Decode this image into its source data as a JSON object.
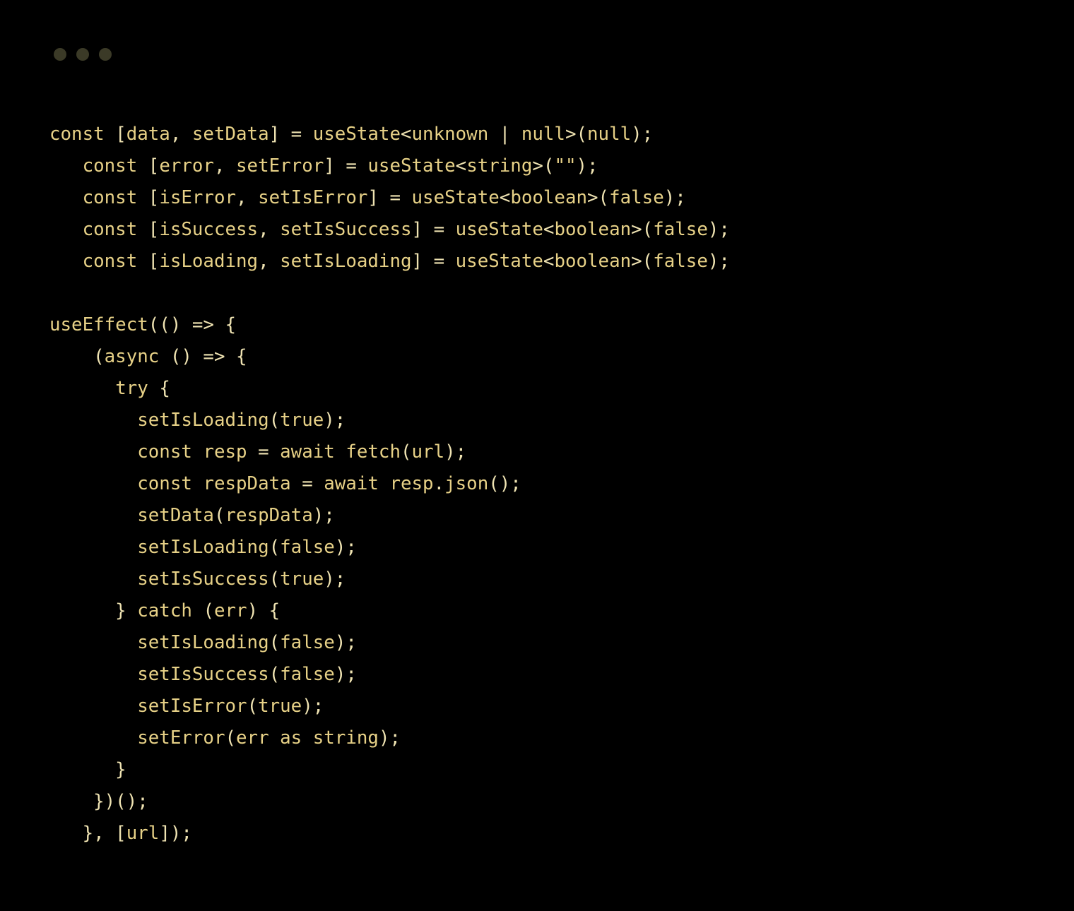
{
  "window": {
    "dots": [
      "close",
      "minimize",
      "zoom"
    ]
  },
  "code": {
    "language": "typescript",
    "tokens": [
      [
        {
          "t": "const ",
          "c": "kw"
        },
        {
          "t": "[",
          "c": "pn"
        },
        {
          "t": "data",
          "c": "id"
        },
        {
          "t": ", ",
          "c": "pn"
        },
        {
          "t": "setData",
          "c": "id"
        },
        {
          "t": "] = ",
          "c": "pn"
        },
        {
          "t": "useState",
          "c": "fn"
        },
        {
          "t": "<",
          "c": "pn"
        },
        {
          "t": "unknown",
          "c": "typ"
        },
        {
          "t": " | ",
          "c": "pn"
        },
        {
          "t": "null",
          "c": "lit"
        },
        {
          "t": ">(",
          "c": "pn"
        },
        {
          "t": "null",
          "c": "lit"
        },
        {
          "t": ");",
          "c": "pn"
        }
      ],
      [
        {
          "t": "   ",
          "c": "pn"
        },
        {
          "t": "const ",
          "c": "kw"
        },
        {
          "t": "[",
          "c": "pn"
        },
        {
          "t": "error",
          "c": "id"
        },
        {
          "t": ", ",
          "c": "pn"
        },
        {
          "t": "setError",
          "c": "id"
        },
        {
          "t": "] = ",
          "c": "pn"
        },
        {
          "t": "useState",
          "c": "fn"
        },
        {
          "t": "<",
          "c": "pn"
        },
        {
          "t": "string",
          "c": "typ"
        },
        {
          "t": ">(",
          "c": "pn"
        },
        {
          "t": "\"\"",
          "c": "str"
        },
        {
          "t": ");",
          "c": "pn"
        }
      ],
      [
        {
          "t": "   ",
          "c": "pn"
        },
        {
          "t": "const ",
          "c": "kw"
        },
        {
          "t": "[",
          "c": "pn"
        },
        {
          "t": "isError",
          "c": "id"
        },
        {
          "t": ", ",
          "c": "pn"
        },
        {
          "t": "setIsError",
          "c": "id"
        },
        {
          "t": "] = ",
          "c": "pn"
        },
        {
          "t": "useState",
          "c": "fn"
        },
        {
          "t": "<",
          "c": "pn"
        },
        {
          "t": "boolean",
          "c": "typ"
        },
        {
          "t": ">(",
          "c": "pn"
        },
        {
          "t": "false",
          "c": "lit"
        },
        {
          "t": ");",
          "c": "pn"
        }
      ],
      [
        {
          "t": "   ",
          "c": "pn"
        },
        {
          "t": "const ",
          "c": "kw"
        },
        {
          "t": "[",
          "c": "pn"
        },
        {
          "t": "isSuccess",
          "c": "id"
        },
        {
          "t": ", ",
          "c": "pn"
        },
        {
          "t": "setIsSuccess",
          "c": "id"
        },
        {
          "t": "] = ",
          "c": "pn"
        },
        {
          "t": "useState",
          "c": "fn"
        },
        {
          "t": "<",
          "c": "pn"
        },
        {
          "t": "boolean",
          "c": "typ"
        },
        {
          "t": ">(",
          "c": "pn"
        },
        {
          "t": "false",
          "c": "lit"
        },
        {
          "t": ");",
          "c": "pn"
        }
      ],
      [
        {
          "t": "   ",
          "c": "pn"
        },
        {
          "t": "const ",
          "c": "kw"
        },
        {
          "t": "[",
          "c": "pn"
        },
        {
          "t": "isLoading",
          "c": "id"
        },
        {
          "t": ", ",
          "c": "pn"
        },
        {
          "t": "setIsLoading",
          "c": "id"
        },
        {
          "t": "] = ",
          "c": "pn"
        },
        {
          "t": "useState",
          "c": "fn"
        },
        {
          "t": "<",
          "c": "pn"
        },
        {
          "t": "boolean",
          "c": "typ"
        },
        {
          "t": ">(",
          "c": "pn"
        },
        {
          "t": "false",
          "c": "lit"
        },
        {
          "t": ");",
          "c": "pn"
        }
      ],
      [],
      [
        {
          "t": "useEffect",
          "c": "fn"
        },
        {
          "t": "(() => {",
          "c": "pn"
        }
      ],
      [
        {
          "t": "    (",
          "c": "pn"
        },
        {
          "t": "async ",
          "c": "kw"
        },
        {
          "t": "() => {",
          "c": "pn"
        }
      ],
      [
        {
          "t": "      ",
          "c": "pn"
        },
        {
          "t": "try ",
          "c": "kw"
        },
        {
          "t": "{",
          "c": "pn"
        }
      ],
      [
        {
          "t": "        ",
          "c": "pn"
        },
        {
          "t": "setIsLoading",
          "c": "fn"
        },
        {
          "t": "(",
          "c": "pn"
        },
        {
          "t": "true",
          "c": "lit"
        },
        {
          "t": ");",
          "c": "pn"
        }
      ],
      [
        {
          "t": "        ",
          "c": "pn"
        },
        {
          "t": "const ",
          "c": "kw"
        },
        {
          "t": "resp",
          "c": "id"
        },
        {
          "t": " = ",
          "c": "pn"
        },
        {
          "t": "await ",
          "c": "kw"
        },
        {
          "t": "fetch",
          "c": "fn"
        },
        {
          "t": "(",
          "c": "pn"
        },
        {
          "t": "url",
          "c": "id"
        },
        {
          "t": ");",
          "c": "pn"
        }
      ],
      [
        {
          "t": "        ",
          "c": "pn"
        },
        {
          "t": "const ",
          "c": "kw"
        },
        {
          "t": "respData",
          "c": "id"
        },
        {
          "t": " = ",
          "c": "pn"
        },
        {
          "t": "await ",
          "c": "kw"
        },
        {
          "t": "resp",
          "c": "id"
        },
        {
          "t": ".",
          "c": "pn"
        },
        {
          "t": "json",
          "c": "fn"
        },
        {
          "t": "();",
          "c": "pn"
        }
      ],
      [
        {
          "t": "        ",
          "c": "pn"
        },
        {
          "t": "setData",
          "c": "fn"
        },
        {
          "t": "(",
          "c": "pn"
        },
        {
          "t": "respData",
          "c": "id"
        },
        {
          "t": ");",
          "c": "pn"
        }
      ],
      [
        {
          "t": "        ",
          "c": "pn"
        },
        {
          "t": "setIsLoading",
          "c": "fn"
        },
        {
          "t": "(",
          "c": "pn"
        },
        {
          "t": "false",
          "c": "lit"
        },
        {
          "t": ");",
          "c": "pn"
        }
      ],
      [
        {
          "t": "        ",
          "c": "pn"
        },
        {
          "t": "setIsSuccess",
          "c": "fn"
        },
        {
          "t": "(",
          "c": "pn"
        },
        {
          "t": "true",
          "c": "lit"
        },
        {
          "t": ");",
          "c": "pn"
        }
      ],
      [
        {
          "t": "      } ",
          "c": "pn"
        },
        {
          "t": "catch ",
          "c": "kw"
        },
        {
          "t": "(",
          "c": "pn"
        },
        {
          "t": "err",
          "c": "id"
        },
        {
          "t": ") {",
          "c": "pn"
        }
      ],
      [
        {
          "t": "        ",
          "c": "pn"
        },
        {
          "t": "setIsLoading",
          "c": "fn"
        },
        {
          "t": "(",
          "c": "pn"
        },
        {
          "t": "false",
          "c": "lit"
        },
        {
          "t": ");",
          "c": "pn"
        }
      ],
      [
        {
          "t": "        ",
          "c": "pn"
        },
        {
          "t": "setIsSuccess",
          "c": "fn"
        },
        {
          "t": "(",
          "c": "pn"
        },
        {
          "t": "false",
          "c": "lit"
        },
        {
          "t": ");",
          "c": "pn"
        }
      ],
      [
        {
          "t": "        ",
          "c": "pn"
        },
        {
          "t": "setIsError",
          "c": "fn"
        },
        {
          "t": "(",
          "c": "pn"
        },
        {
          "t": "true",
          "c": "lit"
        },
        {
          "t": ");",
          "c": "pn"
        }
      ],
      [
        {
          "t": "        ",
          "c": "pn"
        },
        {
          "t": "setError",
          "c": "fn"
        },
        {
          "t": "(",
          "c": "pn"
        },
        {
          "t": "err",
          "c": "id"
        },
        {
          "t": " ",
          "c": "pn"
        },
        {
          "t": "as ",
          "c": "kw"
        },
        {
          "t": "string",
          "c": "typ"
        },
        {
          "t": ");",
          "c": "pn"
        }
      ],
      [
        {
          "t": "      }",
          "c": "pn"
        }
      ],
      [
        {
          "t": "    })();",
          "c": "pn"
        }
      ],
      [
        {
          "t": "   }, [",
          "c": "pn"
        },
        {
          "t": "url",
          "c": "id"
        },
        {
          "t": "]);",
          "c": "pn"
        }
      ]
    ]
  }
}
